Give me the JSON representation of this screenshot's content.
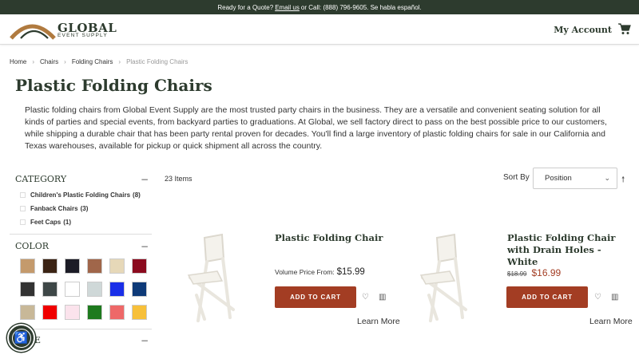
{
  "topbar": {
    "prefix": "Ready for a Quote?",
    "email_link": "Email us",
    "suffix": "or Call: (888) 796-9605. Se habla español."
  },
  "header": {
    "logo_line1": "GLOBAL",
    "logo_line2": "EVENT SUPPLY",
    "account": "My Account",
    "cart_icon": "cart-icon"
  },
  "breadcrumb": [
    "Home",
    "Chairs",
    "Folding Chairs",
    "Plastic Folding Chairs"
  ],
  "page": {
    "title": "Plastic Folding Chairs",
    "description": "Plastic folding chairs from Global Event Supply are the most trusted party chairs in the business. They are a versatile and convenient seating solution for all kinds of parties and special events, from backyard parties to graduations. At Global, we sell factory direct to pass on the best possible price to our customers, while shipping a durable chair that has been party rental proven for decades. You'll find a large inventory of plastic folding chairs for sale in our California and Texas warehouses, available for pickup or quick shipment all across the country."
  },
  "filters": {
    "category": {
      "title": "CATEGORY",
      "items": [
        {
          "label": "Children's Plastic Folding Chairs",
          "count": "(8)"
        },
        {
          "label": "Fanback Chairs",
          "count": "(3)"
        },
        {
          "label": "Feet Caps",
          "count": "(1)"
        }
      ]
    },
    "color": {
      "title": "COLOR",
      "swatches": [
        "#c49a6c",
        "#3b2314",
        "#1c1c26",
        "#a0664a",
        "#e6d8b8",
        "#8b0a1e",
        "#333333",
        "#3e4747",
        "#ffffff",
        "#cfd8d8",
        "#1a2fe8",
        "#0e3a78",
        "#c8b898",
        "#f00000",
        "#fbe3ec",
        "#1e7a1e",
        "#ee6868",
        "#f7c03a"
      ]
    },
    "third": {
      "title": "E"
    }
  },
  "toolbar": {
    "items_count": "23 Items",
    "sort_label": "Sort By",
    "sort_value": "Position"
  },
  "products": [
    {
      "name": "Plastic Folding Chair",
      "price_label": "Volume Price From:",
      "price": "$15.99",
      "add_to_cart": "ADD TO CART",
      "learn_more": "Learn More"
    },
    {
      "name": "Plastic Folding Chair with Drain Holes - White",
      "old_price": "$18.99",
      "price": "$16.99",
      "add_to_cart": "ADD TO CART",
      "learn_more": "Learn More"
    }
  ],
  "colors": {
    "brand_dark": "#2d3b2e",
    "accent": "#a33d23",
    "logo_arc": "#b07a3f"
  }
}
